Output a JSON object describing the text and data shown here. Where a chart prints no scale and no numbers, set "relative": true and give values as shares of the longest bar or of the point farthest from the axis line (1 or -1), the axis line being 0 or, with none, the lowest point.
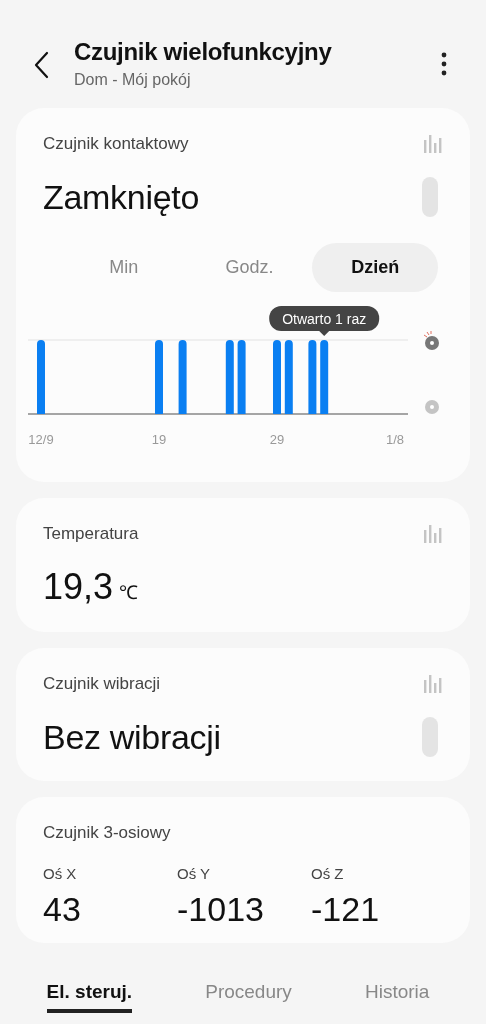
{
  "header": {
    "title": "Czujnik wielofunkcyjny",
    "subtitle": "Dom - Mój pokój"
  },
  "contact_card": {
    "label": "Czujnik kontaktowy",
    "value": "Zamknięto",
    "periods": [
      {
        "label": "Min",
        "selected": false
      },
      {
        "label": "Godz.",
        "selected": false
      },
      {
        "label": "Dzień",
        "selected": true
      }
    ],
    "chart_data": {
      "type": "bar",
      "categories": [
        "12/9",
        null,
        null,
        null,
        null,
        null,
        null,
        null,
        null,
        null,
        "19",
        null,
        null,
        null,
        null,
        null,
        null,
        null,
        null,
        null,
        "29",
        null,
        null,
        null,
        null,
        null,
        null,
        null,
        null,
        null,
        "1/8"
      ],
      "values": [
        1,
        0,
        0,
        0,
        0,
        0,
        0,
        0,
        0,
        0,
        1,
        0,
        1,
        0,
        0,
        0,
        1,
        1,
        0,
        0,
        1,
        1,
        0,
        1,
        1,
        0,
        0,
        0,
        0,
        0,
        0
      ],
      "relative": true,
      "annotations": [
        "Otwarto 1 raz"
      ]
    }
  },
  "temperature_card": {
    "label": "Temperatura",
    "value": "19,3",
    "unit": "℃"
  },
  "vibration_card": {
    "label": "Czujnik wibracji",
    "value": "Bez wibracji"
  },
  "axis_card": {
    "label": "Czujnik 3-osiowy",
    "axes": [
      {
        "label": "Oś X",
        "value": "43"
      },
      {
        "label": "Oś Y",
        "value": "-1013"
      },
      {
        "label": "Oś Z",
        "value": "-121"
      }
    ]
  },
  "bottom_tabs": [
    {
      "label": "El. steruj.",
      "selected": true
    },
    {
      "label": "Procedury",
      "selected": false
    },
    {
      "label": "Historia",
      "selected": false
    }
  ]
}
